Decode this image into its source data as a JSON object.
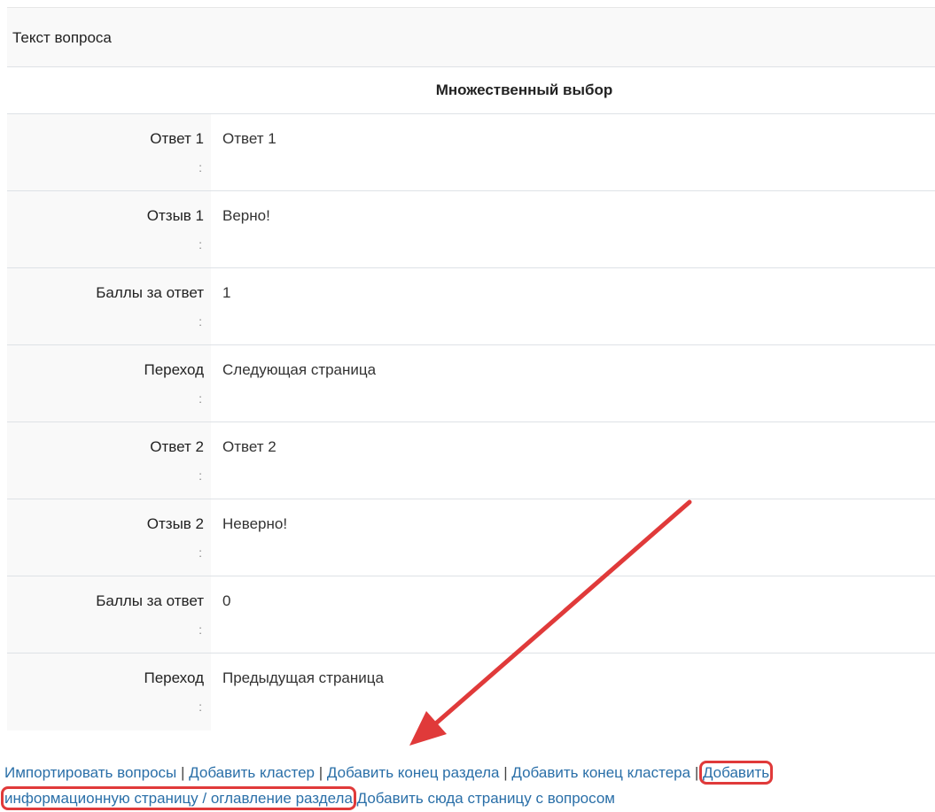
{
  "question_text_label": "Текст вопроса",
  "question_type": "Множественный выбор",
  "colon": ":",
  "rows": [
    {
      "label": "Ответ 1",
      "value": "Ответ 1"
    },
    {
      "label": "Отзыв 1",
      "value": "Верно!"
    },
    {
      "label": "Баллы за ответ",
      "value": "1"
    },
    {
      "label": "Переход",
      "value": "Следующая страница"
    },
    {
      "label": "Ответ 2",
      "value": "Ответ 2"
    },
    {
      "label": "Отзыв 2",
      "value": "Неверно!"
    },
    {
      "label": "Баллы за ответ",
      "value": "0"
    },
    {
      "label": "Переход",
      "value": "Предыдущая страница"
    }
  ],
  "actions": {
    "import": "Импортировать вопросы",
    "add_cluster": "Добавить кластер",
    "add_section_end": "Добавить конец раздела",
    "add_cluster_end": "Добавить конец кластера",
    "add_info_page_part1": "Добавить",
    "add_info_page_part2": "информационную страницу / оглавление раздела",
    "add_question_page": "Добавить сюда страницу с вопросом",
    "separator": "|"
  },
  "colors": {
    "link": "#2a6fa8",
    "highlight": "#e03a3a"
  }
}
